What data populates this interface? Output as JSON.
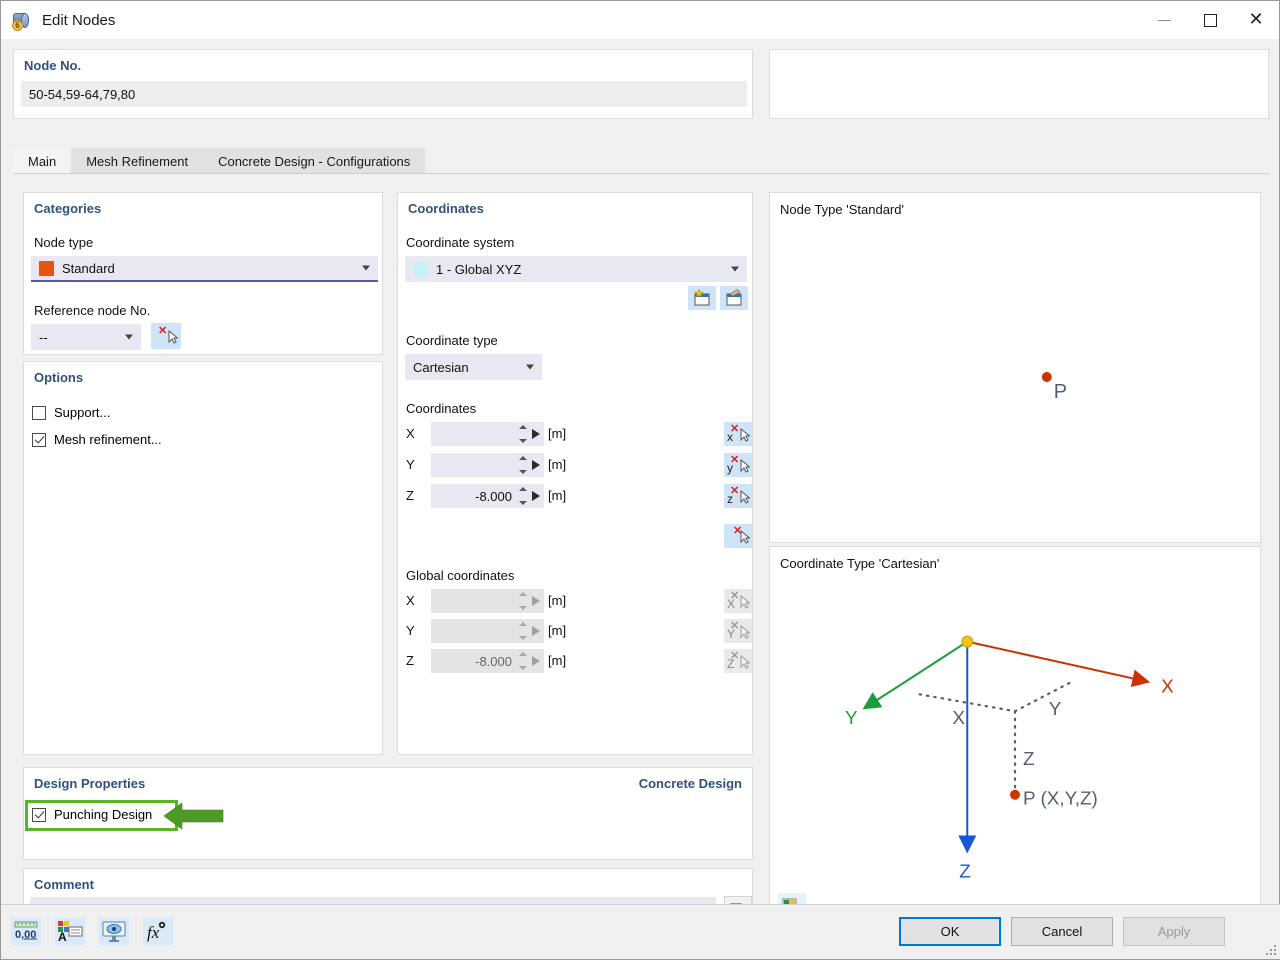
{
  "window": {
    "title": "Edit Nodes",
    "icon": "node-cube-icon",
    "controls": {
      "minimize": "minimize-icon",
      "maximize": "maximize-icon",
      "close": "close-icon"
    }
  },
  "node_no": {
    "label": "Node No.",
    "value": "50-54,59-64,79,80"
  },
  "tabs": [
    {
      "label": "Main",
      "active": true
    },
    {
      "label": "Mesh Refinement",
      "active": false
    },
    {
      "label": "Concrete Design - Configurations",
      "active": false
    }
  ],
  "categories": {
    "title": "Categories",
    "node_type_label": "Node type",
    "node_type_value": "Standard",
    "node_type_swatch": "#e8530e",
    "reference_node_label": "Reference node No.",
    "reference_node_value": "--",
    "reference_node_pick": "pick-node-icon"
  },
  "options": {
    "title": "Options",
    "items": [
      {
        "label": "Support...",
        "checked": false
      },
      {
        "label": "Mesh refinement...",
        "checked": true
      }
    ]
  },
  "coordinates": {
    "title": "Coordinates",
    "system_label": "Coordinate system",
    "system_value": "1 - Global XYZ",
    "system_swatch": "#c9f0f4",
    "new_cs_icon": "new-coordinate-system-icon",
    "edit_cs_icon": "edit-coordinate-system-icon",
    "type_label": "Coordinate type",
    "type_value": "Cartesian",
    "local_title": "Coordinates",
    "local_rows": [
      {
        "axis": "X",
        "value": "",
        "unit": "[m]",
        "pick": "pick-x-icon",
        "disabled": false
      },
      {
        "axis": "Y",
        "value": "",
        "unit": "[m]",
        "pick": "pick-y-icon",
        "disabled": false
      },
      {
        "axis": "Z",
        "value": "-8.000",
        "unit": "[m]",
        "pick": "pick-z-icon",
        "disabled": false
      }
    ],
    "pick_point_icon": "pick-point-icon",
    "global_title": "Global coordinates",
    "global_rows": [
      {
        "axis": "X",
        "value": "",
        "unit": "[m]",
        "pick": "pick-global-x-icon",
        "disabled": true
      },
      {
        "axis": "Y",
        "value": "",
        "unit": "[m]",
        "pick": "pick-global-y-icon",
        "disabled": true
      },
      {
        "axis": "Z",
        "value": "-8.000",
        "unit": "[m]",
        "pick": "pick-global-z-icon",
        "disabled": true
      }
    ]
  },
  "design_properties": {
    "title": "Design Properties",
    "right_label": "Concrete Design",
    "punching_design_label": "Punching Design",
    "punching_design_checked": true,
    "annotation_arrow_color": "#4f9a26",
    "highlight_color": "#55b722"
  },
  "comment": {
    "title": "Comment",
    "value": "",
    "button_icon": "comment-library-icon"
  },
  "preview_node": {
    "label": "Node Type 'Standard'",
    "point_label": "P",
    "point_color": "#cc3300"
  },
  "preview_cartesian": {
    "label": "Coordinate Type 'Cartesian'",
    "axes": [
      {
        "name": "X",
        "color": "#cc3300"
      },
      {
        "name": "Y",
        "color": "#1a9e3c"
      },
      {
        "name": "Z",
        "color": "#1457d6"
      }
    ],
    "projection_labels": [
      "X",
      "Y",
      "Z"
    ],
    "point_label": "P (X,Y,Z)",
    "origin_color": "#f2c411",
    "settings_icon": "render-settings-icon"
  },
  "footer": {
    "icons": [
      {
        "name": "number-format-icon",
        "label": "0,00"
      },
      {
        "name": "display-properties-icon",
        "label": ""
      },
      {
        "name": "visibility-icon",
        "label": ""
      },
      {
        "name": "formula-icon",
        "label": "fx"
      }
    ],
    "buttons": [
      {
        "label": "OK",
        "state": "primary"
      },
      {
        "label": "Cancel",
        "state": "normal"
      },
      {
        "label": "Apply",
        "state": "disabled"
      }
    ]
  }
}
